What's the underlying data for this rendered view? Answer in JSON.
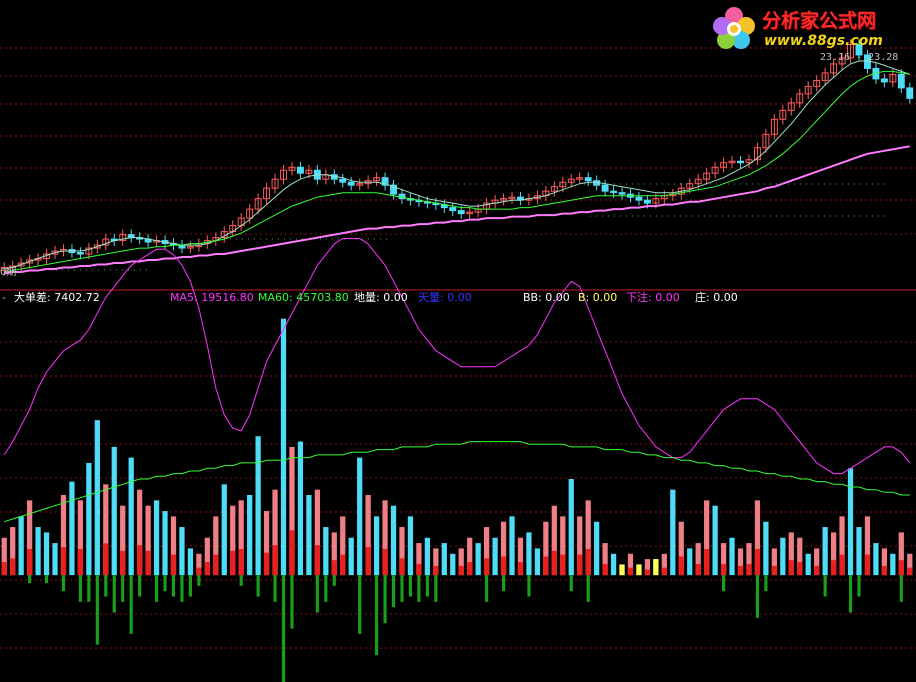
{
  "logo": {
    "site_name": "分析家公式网",
    "url": "www.88gs.com"
  },
  "price_tag": "23.16 - 23.28",
  "axis_tag": "0期",
  "legend": [
    {
      "key": "dash",
      "label": "-",
      "value": "",
      "color": "#c0c0c0"
    },
    {
      "key": "big_order_diff",
      "label": "大单差: ",
      "value": "7402.72",
      "color": "#ffffff"
    },
    {
      "key": "ma5",
      "label": "MA5: ",
      "value": "19516.80",
      "color": "#ff33ff"
    },
    {
      "key": "ma60",
      "label": "MA60: ",
      "value": "45703.80",
      "color": "#33ff33"
    },
    {
      "key": "diliang",
      "label": "地量: ",
      "value": "0.00",
      "color": "#ffffff"
    },
    {
      "key": "tianliang",
      "label": "天量: ",
      "value": "0.00",
      "color": "#3333ff"
    },
    {
      "key": "bb",
      "label": "BB: ",
      "value": "0.00",
      "color": "#ffffff"
    },
    {
      "key": "b",
      "label": "B: ",
      "value": "0.00",
      "color": "#ffff66"
    },
    {
      "key": "xiazhu",
      "label": "下注: ",
      "value": "0.00",
      "color": "#ff33ff"
    },
    {
      "key": "zhuang",
      "label": "庄: ",
      "value": "0.00",
      "color": "#ffffff"
    }
  ],
  "colors": {
    "background": "#000000",
    "grid": "#8b1010",
    "separator": "#c81e1e",
    "up": "#ff5c5c",
    "up_fill": "#ef7f87",
    "down": "#4fdcf6",
    "negative": "#18a018",
    "ma_short": "#ff33ff",
    "ma_long": "#33ff33",
    "price_ma": "#ff7bff",
    "red_base": "#e82020",
    "yellow": "#ffff55"
  },
  "chart_data": [
    {
      "type": "candlestick",
      "pane": "price",
      "bars": 108,
      "y_range": [
        10.0,
        25.5
      ],
      "close": [
        10.3,
        10.4,
        10.6,
        10.8,
        10.9,
        11.2,
        11.4,
        11.5,
        11.3,
        11.2,
        11.6,
        11.8,
        12.2,
        12.1,
        12.5,
        12.3,
        12.2,
        12.0,
        12.1,
        11.9,
        11.8,
        11.6,
        11.7,
        11.9,
        12.1,
        12.3,
        12.7,
        13.1,
        13.6,
        14.2,
        14.9,
        15.6,
        16.2,
        16.8,
        17.0,
        16.6,
        16.8,
        16.2,
        16.5,
        16.2,
        16.0,
        15.8,
        15.9,
        16.1,
        16.3,
        15.8,
        15.2,
        14.9,
        14.8,
        14.7,
        14.6,
        14.5,
        14.3,
        14.1,
        13.9,
        14.0,
        14.2,
        14.6,
        14.8,
        14.9,
        15.0,
        14.8,
        14.9,
        15.1,
        15.4,
        15.7,
        16.0,
        16.2,
        16.3,
        16.1,
        15.8,
        15.4,
        15.3,
        15.2,
        15.0,
        14.8,
        14.6,
        14.9,
        15.1,
        15.2,
        15.6,
        15.9,
        16.2,
        16.6,
        17.0,
        17.3,
        17.4,
        17.3,
        17.5,
        18.3,
        19.2,
        20.2,
        20.8,
        21.3,
        21.9,
        22.4,
        22.8,
        23.3,
        23.9,
        24.3,
        25.2,
        24.5,
        23.6,
        22.9,
        22.7,
        23.2,
        22.3,
        21.6
      ],
      "ma_line_1": [
        10.2,
        10.3,
        10.5,
        10.7,
        10.9,
        11.1,
        11.3,
        11.4,
        11.4,
        11.4,
        11.5,
        11.7,
        11.9,
        12.1,
        12.2,
        12.3,
        12.3,
        12.2,
        12.1,
        12.0,
        11.9,
        11.8,
        11.8,
        11.8,
        11.9,
        12.1,
        12.4,
        12.7,
        13.1,
        13.5,
        14.0,
        14.5,
        15.0,
        15.5,
        15.9,
        16.2,
        16.4,
        16.5,
        16.5,
        16.4,
        16.3,
        16.1,
        16.0,
        16.0,
        16.0,
        15.9,
        15.7,
        15.5,
        15.3,
        15.1,
        14.9,
        14.8,
        14.7,
        14.6,
        14.5,
        14.4,
        14.4,
        14.5,
        14.6,
        14.7,
        14.8,
        14.8,
        14.9,
        15.0,
        15.1,
        15.3,
        15.5,
        15.7,
        15.9,
        16.0,
        16.0,
        15.9,
        15.8,
        15.7,
        15.6,
        15.5,
        15.4,
        15.3,
        15.3,
        15.3,
        15.4,
        15.5,
        15.7,
        15.9,
        16.1,
        16.3,
        16.6,
        16.9,
        17.2,
        17.6,
        18.1,
        18.7,
        19.3,
        19.9,
        20.6,
        21.3,
        21.9,
        22.5,
        23.0,
        23.5,
        23.9,
        24.1,
        24.1,
        24.0,
        23.8,
        23.6,
        23.4,
        23.2
      ],
      "ma_line_2": [
        10.0,
        10.1,
        10.2,
        10.3,
        10.4,
        10.5,
        10.6,
        10.7,
        10.8,
        10.9,
        11.0,
        11.1,
        11.2,
        11.3,
        11.4,
        11.5,
        11.6,
        11.6,
        11.7,
        11.7,
        11.8,
        11.8,
        11.9,
        11.9,
        12.0,
        12.1,
        12.2,
        12.4,
        12.6,
        12.9,
        13.2,
        13.5,
        13.8,
        14.1,
        14.4,
        14.6,
        14.8,
        15.0,
        15.1,
        15.2,
        15.3,
        15.3,
        15.3,
        15.3,
        15.3,
        15.2,
        15.1,
        15.0,
        14.9,
        14.8,
        14.7,
        14.6,
        14.5,
        14.4,
        14.3,
        14.3,
        14.2,
        14.2,
        14.2,
        14.2,
        14.2,
        14.3,
        14.3,
        14.4,
        14.5,
        14.6,
        14.7,
        14.8,
        14.9,
        15.0,
        15.1,
        15.1,
        15.1,
        15.1,
        15.1,
        15.1,
        15.1,
        15.1,
        15.1,
        15.2,
        15.3,
        15.4,
        15.5,
        15.6,
        15.7,
        15.9,
        16.1,
        16.3,
        16.5,
        16.8,
        17.1,
        17.5,
        17.9,
        18.4,
        18.9,
        19.5,
        20.1,
        20.7,
        21.3,
        21.9,
        22.4,
        22.8,
        23.1,
        23.3,
        23.4,
        23.4,
        23.3,
        23.2
      ],
      "ma_line_3": [
        9.9,
        10.0,
        10.0,
        10.1,
        10.1,
        10.2,
        10.2,
        10.3,
        10.3,
        10.4,
        10.4,
        10.5,
        10.5,
        10.6,
        10.6,
        10.7,
        10.7,
        10.8,
        10.8,
        10.9,
        10.9,
        11.0,
        11.0,
        11.1,
        11.1,
        11.2,
        11.2,
        11.3,
        11.4,
        11.5,
        11.6,
        11.7,
        11.8,
        11.9,
        12.0,
        12.1,
        12.2,
        12.3,
        12.4,
        12.5,
        12.6,
        12.7,
        12.8,
        12.9,
        12.9,
        13.0,
        13.0,
        13.1,
        13.1,
        13.2,
        13.2,
        13.3,
        13.3,
        13.4,
        13.4,
        13.5,
        13.5,
        13.6,
        13.6,
        13.6,
        13.7,
        13.7,
        13.7,
        13.8,
        13.8,
        13.8,
        13.9,
        13.9,
        14.0,
        14.0,
        14.1,
        14.1,
        14.2,
        14.2,
        14.3,
        14.3,
        14.4,
        14.4,
        14.5,
        14.5,
        14.6,
        14.7,
        14.7,
        14.8,
        14.9,
        15.0,
        15.1,
        15.2,
        15.3,
        15.4,
        15.6,
        15.7,
        15.9,
        16.1,
        16.3,
        16.5,
        16.7,
        16.9,
        17.1,
        17.3,
        17.5,
        17.7,
        17.9,
        18.0,
        18.1,
        18.2,
        18.3,
        18.4
      ]
    },
    {
      "type": "bar",
      "pane": "indicator",
      "title": "大单差",
      "bars": 108,
      "y_range": [
        -40000,
        100000
      ],
      "values": [
        14000,
        18000,
        22000,
        28000,
        18000,
        16000,
        12000,
        30000,
        35000,
        28000,
        42000,
        58000,
        34000,
        48000,
        26000,
        44000,
        32000,
        26000,
        28000,
        24000,
        22000,
        18000,
        10000,
        8000,
        14000,
        22000,
        34000,
        26000,
        28000,
        30000,
        52000,
        24000,
        32000,
        96000,
        48000,
        50000,
        30000,
        32000,
        18000,
        16000,
        22000,
        14000,
        44000,
        30000,
        22000,
        28000,
        26000,
        18000,
        22000,
        12000,
        14000,
        10000,
        12000,
        8000,
        10000,
        14000,
        12000,
        18000,
        14000,
        20000,
        22000,
        14000,
        16000,
        10000,
        20000,
        26000,
        22000,
        36000,
        22000,
        28000,
        20000,
        12000,
        8000,
        4000,
        8000,
        4000,
        6000,
        6000,
        8000,
        32000,
        20000,
        10000,
        12000,
        28000,
        26000,
        12000,
        14000,
        10000,
        12000,
        28000,
        20000,
        10000,
        14000,
        16000,
        14000,
        8000,
        10000,
        18000,
        16000,
        22000,
        40000,
        18000,
        22000,
        12000,
        10000,
        8000,
        16000,
        8000
      ],
      "directions": [
        "up",
        "up",
        "down",
        "up",
        "down",
        "down",
        "down",
        "up",
        "down",
        "up",
        "down",
        "down",
        "up",
        "down",
        "up",
        "down",
        "up",
        "up",
        "down",
        "down",
        "up",
        "down",
        "down",
        "up",
        "up",
        "up",
        "down",
        "up",
        "up",
        "down",
        "down",
        "up",
        "up",
        "down",
        "up",
        "down",
        "down",
        "up",
        "down",
        "up",
        "up",
        "down",
        "down",
        "up",
        "down",
        "up",
        "down",
        "up",
        "down",
        "up",
        "down",
        "up",
        "down",
        "down",
        "up",
        "up",
        "down",
        "up",
        "down",
        "up",
        "down",
        "up",
        "down",
        "down",
        "up",
        "up",
        "up",
        "down",
        "up",
        "up",
        "down",
        "up",
        "down",
        "up",
        "up",
        "up",
        "up",
        "down",
        "up",
        "down",
        "up",
        "down",
        "up",
        "up",
        "down",
        "up",
        "down",
        "up",
        "up",
        "up",
        "down",
        "up",
        "down",
        "up",
        "up",
        "down",
        "up",
        "down",
        "up",
        "up",
        "down",
        "down",
        "up",
        "down",
        "up",
        "down",
        "up",
        "up"
      ],
      "negatives": [
        0,
        0,
        0,
        -3000,
        0,
        -3000,
        0,
        -6000,
        0,
        -10000,
        -10000,
        -26000,
        -8000,
        -14000,
        -10000,
        -22000,
        -8000,
        0,
        -10000,
        -6000,
        -8000,
        -10000,
        -8000,
        -4000,
        0,
        0,
        0,
        0,
        -4000,
        0,
        -8000,
        0,
        -10000,
        -40000,
        -20000,
        0,
        0,
        -14000,
        -10000,
        -4000,
        0,
        0,
        -22000,
        0,
        -30000,
        -18000,
        -12000,
        -10000,
        -8000,
        -10000,
        -8000,
        -10000,
        0,
        0,
        0,
        0,
        0,
        -10000,
        0,
        -6000,
        0,
        0,
        -8000,
        0,
        0,
        0,
        0,
        -6000,
        0,
        -10000,
        0,
        0,
        0,
        0,
        0,
        0,
        0,
        0,
        0,
        0,
        0,
        0,
        0,
        0,
        0,
        -6000,
        0,
        0,
        0,
        -16000,
        -6000,
        0,
        0,
        0,
        0,
        0,
        0,
        -8000,
        0,
        0,
        -14000,
        -8000,
        0,
        0,
        0,
        0,
        -10000,
        0
      ],
      "ma5": [
        45000,
        50000,
        56000,
        62000,
        70000,
        76000,
        80000,
        84000,
        86000,
        88000,
        92000,
        98000,
        104000,
        108000,
        112000,
        116000,
        118000,
        120000,
        122000,
        122000,
        120000,
        116000,
        110000,
        100000,
        86000,
        70000,
        60000,
        55000,
        54000,
        60000,
        70000,
        80000,
        86000,
        92000,
        98000,
        104000,
        110000,
        116000,
        120000,
        124000,
        126000,
        126000,
        126000,
        124000,
        120000,
        116000,
        110000,
        104000,
        98000,
        92000,
        88000,
        84000,
        82000,
        80000,
        78000,
        78000,
        78000,
        78000,
        78000,
        80000,
        82000,
        84000,
        86000,
        90000,
        96000,
        102000,
        106000,
        110000,
        108000,
        100000,
        92000,
        84000,
        76000,
        68000,
        62000,
        56000,
        52000,
        48000,
        46000,
        44000,
        44000,
        46000,
        50000,
        54000,
        58000,
        62000,
        64000,
        66000,
        66000,
        66000,
        64000,
        62000,
        58000,
        54000,
        50000,
        46000,
        42000,
        40000,
        38000,
        38000,
        40000,
        42000,
        44000,
        46000,
        48000,
        48000,
        46000,
        42000
      ],
      "ma60": [
        20000,
        21000,
        22000,
        23000,
        24000,
        25000,
        26000,
        27000,
        28000,
        29000,
        30000,
        31000,
        32000,
        33000,
        34000,
        35000,
        36000,
        36000,
        37000,
        37000,
        38000,
        38000,
        39000,
        39000,
        40000,
        40000,
        41000,
        41000,
        42000,
        42000,
        42000,
        43000,
        43000,
        43000,
        44000,
        44000,
        44000,
        45000,
        45000,
        45000,
        45000,
        46000,
        46000,
        46000,
        47000,
        47000,
        47000,
        48000,
        48000,
        48000,
        48000,
        49000,
        49000,
        49000,
        49000,
        50000,
        50000,
        50000,
        50000,
        50000,
        50000,
        50000,
        49000,
        49000,
        49000,
        49000,
        49000,
        48000,
        48000,
        48000,
        48000,
        47000,
        47000,
        47000,
        46000,
        46000,
        45000,
        45000,
        44000,
        44000,
        43000,
        43000,
        42000,
        42000,
        41000,
        41000,
        40000,
        40000,
        39000,
        39000,
        38000,
        38000,
        37000,
        37000,
        36000,
        36000,
        35000,
        35000,
        34000,
        34000,
        33000,
        33000,
        32000,
        32000,
        31000,
        31000,
        30000,
        30000
      ]
    }
  ]
}
